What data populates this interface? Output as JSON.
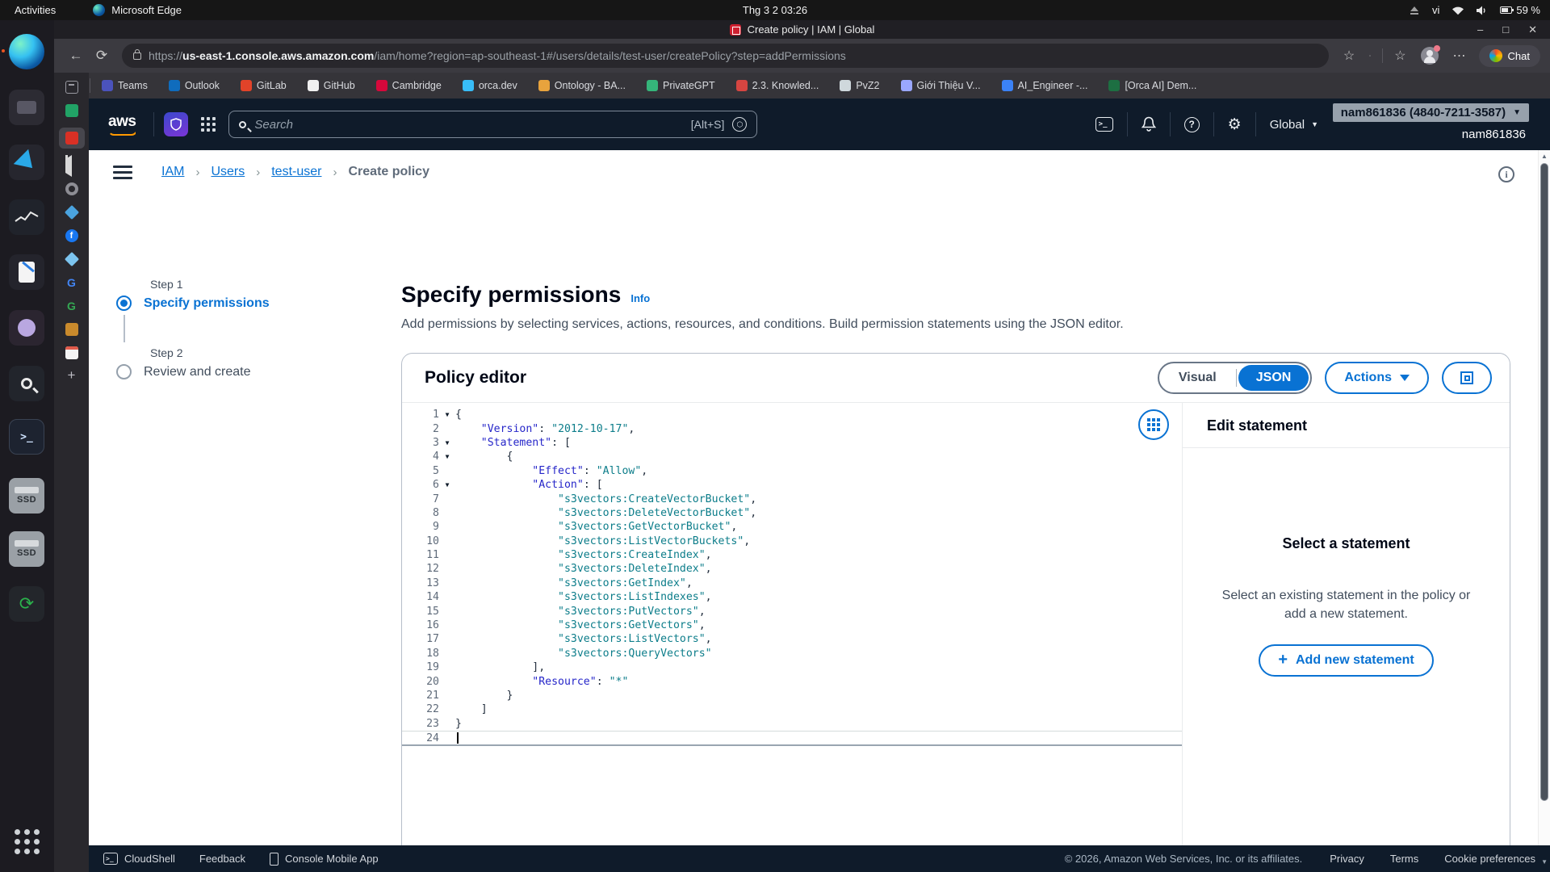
{
  "glyphs": {
    "chevron": "›",
    "caret_down": "▼",
    "plus": "+",
    "more": "⋯",
    "star": "☆",
    "minimize": "–",
    "maximize": "□",
    "close": "✕",
    "scroll_up": "▲",
    "scroll_down": "▼",
    "back": "←",
    "refresh": "⟳",
    "gear": "⚙",
    "question": "?",
    "info_i": "i",
    "terminal_prompt": ">_",
    "recycle": "⟳"
  },
  "desktop": {
    "topbar": {
      "activities": "Activities",
      "app_name": "Microsoft Edge",
      "clock": "Thg 3 2  03:26",
      "input_lang": "vi",
      "battery_percent": "59 %"
    },
    "dock": {
      "items": [
        "edge",
        "files",
        "vscode",
        "system-monitor",
        "text-editor",
        "github-desktop",
        "search-tool",
        "terminal",
        "ssd-drive",
        "ssd-drive",
        "software-updater",
        "show-applications"
      ],
      "ssd_label": "SSD"
    }
  },
  "browser": {
    "tab_title": "Create policy | IAM | Global",
    "chat_label": "Chat",
    "url": {
      "scheme": "https://",
      "host": "us-east-1.console.aws.amazon.com",
      "path": "/iam/home?region=ap-southeast-1#/users/details/test-user/createPolicy?step=addPermissions"
    },
    "bookmarks": [
      {
        "label": "Teams",
        "c": "#4b53bc"
      },
      {
        "label": "Outlook",
        "c": "#0f6cbd"
      },
      {
        "label": "GitLab",
        "c": "#e24329"
      },
      {
        "label": "GitHub",
        "c": "#f0f0f0"
      },
      {
        "label": "Cambridge",
        "c": "#d6083b"
      },
      {
        "label": "orca.dev",
        "c": "#38bdf8"
      },
      {
        "label": "Ontology - BA...",
        "c": "#e8a33d"
      },
      {
        "label": "PrivateGPT",
        "c": "#35b57a"
      },
      {
        "label": "2.3. Knowled...",
        "c": "#d64541"
      },
      {
        "label": "PvZ2",
        "c": "#cfd8dc"
      },
      {
        "label": "Giới Thiệu V...",
        "c": "#9aa7ff"
      },
      {
        "label": "AI_Engineer -...",
        "c": "#3b82f6"
      },
      {
        "label": "[Orca AI] Dem...",
        "c": "#1d6f42"
      }
    ]
  },
  "aws": {
    "search_placeholder": "Search",
    "search_shortcut": "[Alt+S]",
    "region": "Global",
    "account_chip": "nam861836 (4840-7211-3587)",
    "account_name": "nam861836",
    "breadcrumb": [
      "IAM",
      "Users",
      "test-user",
      "Create policy"
    ],
    "steps": [
      {
        "step": "Step 1",
        "label": "Specify permissions",
        "active": true
      },
      {
        "step": "Step 2",
        "label": "Review and create",
        "active": false
      }
    ],
    "page": {
      "title": "Specify permissions",
      "info_label": "Info",
      "description": "Add permissions by selecting services, actions, resources, and conditions. Build permission statements using the JSON editor."
    },
    "editor": {
      "title": "Policy editor",
      "visual_label": "Visual",
      "json_label": "JSON",
      "actions_label": "Actions",
      "lines": [
        [
          1,
          1,
          0,
          [
            [
              "p",
              "{"
            ]
          ]
        ],
        [
          2,
          0,
          4,
          [
            [
              "k",
              "\"Version\""
            ],
            [
              "p",
              ": "
            ],
            [
              "s",
              "\"2012-10-17\""
            ],
            [
              "p",
              ","
            ]
          ]
        ],
        [
          3,
          1,
          4,
          [
            [
              "k",
              "\"Statement\""
            ],
            [
              "p",
              ": ["
            ]
          ]
        ],
        [
          4,
          1,
          8,
          [
            [
              "p",
              "{"
            ]
          ]
        ],
        [
          5,
          0,
          12,
          [
            [
              "k",
              "\"Effect\""
            ],
            [
              "p",
              ": "
            ],
            [
              "s",
              "\"Allow\""
            ],
            [
              "p",
              ","
            ]
          ]
        ],
        [
          6,
          1,
          12,
          [
            [
              "k",
              "\"Action\""
            ],
            [
              "p",
              ": ["
            ]
          ]
        ],
        [
          7,
          0,
          16,
          [
            [
              "s",
              "\"s3vectors:CreateVectorBucket\""
            ],
            [
              "p",
              ","
            ]
          ]
        ],
        [
          8,
          0,
          16,
          [
            [
              "s",
              "\"s3vectors:DeleteVectorBucket\""
            ],
            [
              "p",
              ","
            ]
          ]
        ],
        [
          9,
          0,
          16,
          [
            [
              "s",
              "\"s3vectors:GetVectorBucket\""
            ],
            [
              "p",
              ","
            ]
          ]
        ],
        [
          10,
          0,
          16,
          [
            [
              "s",
              "\"s3vectors:ListVectorBuckets\""
            ],
            [
              "p",
              ","
            ]
          ]
        ],
        [
          11,
          0,
          16,
          [
            [
              "s",
              "\"s3vectors:CreateIndex\""
            ],
            [
              "p",
              ","
            ]
          ]
        ],
        [
          12,
          0,
          16,
          [
            [
              "s",
              "\"s3vectors:DeleteIndex\""
            ],
            [
              "p",
              ","
            ]
          ]
        ],
        [
          13,
          0,
          16,
          [
            [
              "s",
              "\"s3vectors:GetIndex\""
            ],
            [
              "p",
              ","
            ]
          ]
        ],
        [
          14,
          0,
          16,
          [
            [
              "s",
              "\"s3vectors:ListIndexes\""
            ],
            [
              "p",
              ","
            ]
          ]
        ],
        [
          15,
          0,
          16,
          [
            [
              "s",
              "\"s3vectors:PutVectors\""
            ],
            [
              "p",
              ","
            ]
          ]
        ],
        [
          16,
          0,
          16,
          [
            [
              "s",
              "\"s3vectors:GetVectors\""
            ],
            [
              "p",
              ","
            ]
          ]
        ],
        [
          17,
          0,
          16,
          [
            [
              "s",
              "\"s3vectors:ListVectors\""
            ],
            [
              "p",
              ","
            ]
          ]
        ],
        [
          18,
          0,
          16,
          [
            [
              "s",
              "\"s3vectors:QueryVectors\""
            ]
          ]
        ],
        [
          19,
          0,
          12,
          [
            [
              "p",
              "],"
            ]
          ]
        ],
        [
          20,
          0,
          12,
          [
            [
              "k",
              "\"Resource\""
            ],
            [
              "p",
              ": "
            ],
            [
              "s",
              "\"*\""
            ]
          ]
        ],
        [
          21,
          0,
          8,
          [
            [
              "p",
              "}"
            ]
          ]
        ],
        [
          22,
          0,
          4,
          [
            [
              "p",
              "]"
            ]
          ]
        ],
        [
          23,
          0,
          0,
          [
            [
              "p",
              "}"
            ]
          ]
        ],
        [
          24,
          0,
          0,
          [],
          1
        ]
      ]
    },
    "statement_panel": {
      "title": "Edit statement",
      "empty_title": "Select a statement",
      "empty_text": "Select an existing statement in the policy or add a new statement.",
      "add_button": "Add new statement"
    },
    "footer": {
      "cloudshell": "CloudShell",
      "feedback": "Feedback",
      "mobile_app": "Console Mobile App",
      "copyright": "© 2026, Amazon Web Services, Inc. or its affiliates.",
      "privacy": "Privacy",
      "terms": "Terms",
      "cookies": "Cookie preferences"
    },
    "colors": {
      "accent_blue": "#0972d3",
      "header_bg": "#0f1b2a",
      "code_key": "#2626c9",
      "code_string": "#0c7d8a"
    }
  }
}
